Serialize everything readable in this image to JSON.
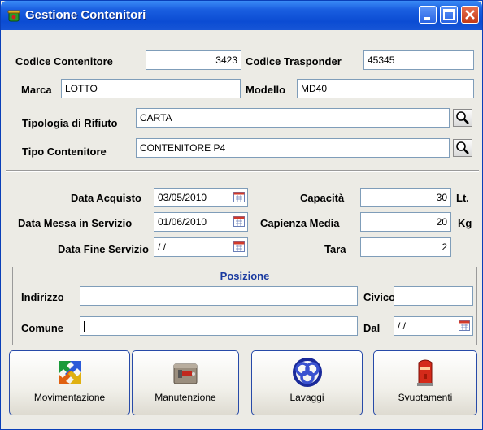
{
  "window": {
    "title": "Gestione Contenitori",
    "app_icon": "recycle-bin-icon",
    "controls": [
      "minimize-icon",
      "maximize-icon",
      "close-icon"
    ]
  },
  "header_fields": {
    "codice_contenitore": {
      "label": "Codice Contenitore",
      "value": "3423"
    },
    "codice_trasponder": {
      "label": "Codice Trasponder",
      "value": "45345"
    },
    "marca": {
      "label": "Marca",
      "value": "LOTTO"
    },
    "modello": {
      "label": "Modello",
      "value": "MD40"
    },
    "tipologia_rifiuto": {
      "label": "Tipologia di Rifiuto",
      "value": "CARTA"
    },
    "tipo_contenitore": {
      "label": "Tipo Contenitore",
      "value": "CONTENITORE P4"
    }
  },
  "details": {
    "data_acquisto": {
      "label": "Data Acquisto",
      "value": "03/05/2010"
    },
    "data_messa_servizio": {
      "label": "Data Messa in Servizio",
      "value": "01/06/2010"
    },
    "data_fine_servizio": {
      "label": "Data Fine Servizio",
      "value": " / /"
    },
    "capacita": {
      "label": "Capacità",
      "value": "30",
      "unit": "Lt."
    },
    "capienza_media": {
      "label": "Capienza Media",
      "value": "20",
      "unit": "Kg"
    },
    "tara": {
      "label": "Tara",
      "value": "2"
    }
  },
  "posizione": {
    "title": "Posizione",
    "indirizzo": {
      "label": "Indirizzo",
      "value": ""
    },
    "civico": {
      "label": "Civico",
      "value": ""
    },
    "comune": {
      "label": "Comune",
      "value": ""
    },
    "dal": {
      "label": "Dal",
      "value": " / /"
    }
  },
  "actions": [
    {
      "label": "Movimentazione",
      "icon": "movement-arrows-icon"
    },
    {
      "label": "Manutenzione",
      "icon": "maintenance-tool-icon"
    },
    {
      "label": "Lavaggi",
      "icon": "washing-knot-icon"
    },
    {
      "label": "Svuotamenti",
      "icon": "mailbox-bin-icon"
    }
  ],
  "colors": {
    "titlebar": "#0b4cd3",
    "panel_title": "#1a3aa0",
    "window_bg": "#ecebe5"
  }
}
